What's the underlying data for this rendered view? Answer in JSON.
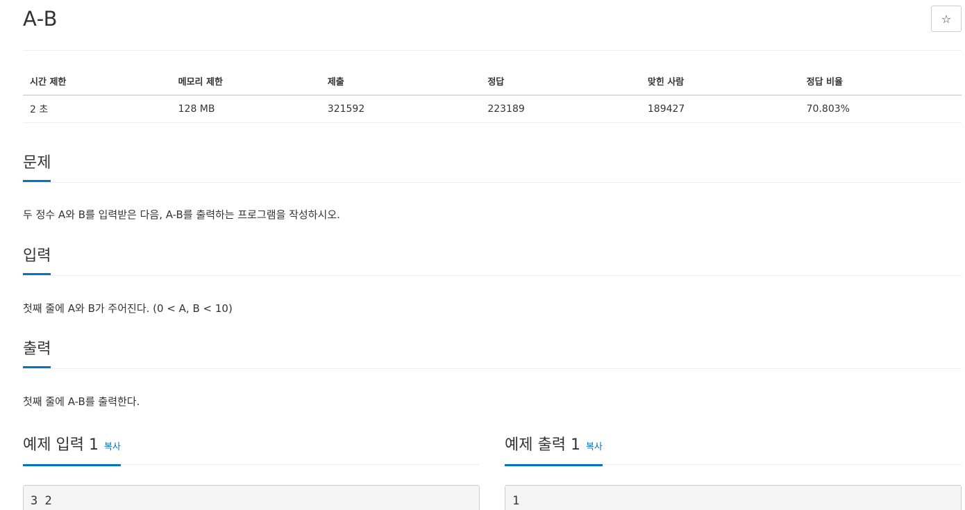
{
  "problem": {
    "title": "A-B",
    "star_icon": "☆"
  },
  "info_table": {
    "headers": [
      "시간 제한",
      "메모리 제한",
      "제출",
      "정답",
      "맞힌 사람",
      "정답 비율"
    ],
    "values": [
      "2 초",
      "128 MB",
      "321592",
      "223189",
      "189427",
      "70.803%"
    ]
  },
  "sections": {
    "description": {
      "heading": "문제",
      "text": "두 정수 A와 B를 입력받은 다음, A-B를 출력하는 프로그램을 작성하시오."
    },
    "input": {
      "heading": "입력",
      "text": "첫째 줄에 A와 B가 주어진다. (0 < A, B < 10)"
    },
    "output": {
      "heading": "출력",
      "text": "첫째 줄에 A-B를 출력한다."
    }
  },
  "samples": {
    "input": {
      "heading": "예제 입력 1",
      "copy_label": "복사",
      "content": "3 2"
    },
    "output": {
      "heading": "예제 출력 1",
      "copy_label": "복사",
      "content": "1"
    }
  },
  "colors": {
    "accent": "#0076c0",
    "text": "#333333",
    "border": "#eeeeee",
    "sample_bg": "#f5f5f5"
  }
}
